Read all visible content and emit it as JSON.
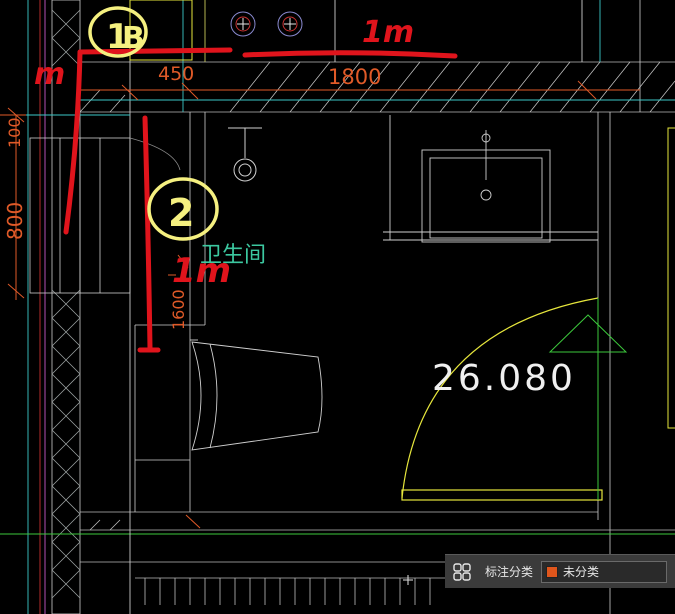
{
  "drawing": {
    "dims": {
      "d450": "450",
      "d1800": "1800",
      "d100": "100",
      "d800": "800",
      "d1600": "1600"
    },
    "room_name": "卫生间",
    "elevation": "26.080",
    "annotations": {
      "a1": "1",
      "a1_suffix": "B",
      "a1m_top": "1m",
      "a1m_left": "m",
      "a2": "2",
      "a2m": "1m"
    }
  },
  "statusbar": {
    "label": "标注分类",
    "value": "未分类",
    "swatch_color": "#e0561c"
  },
  "colors": {
    "annotation_red": "#e0141c",
    "annotation_yellow": "#f5f080",
    "dimension_orange": "#e05a28"
  }
}
